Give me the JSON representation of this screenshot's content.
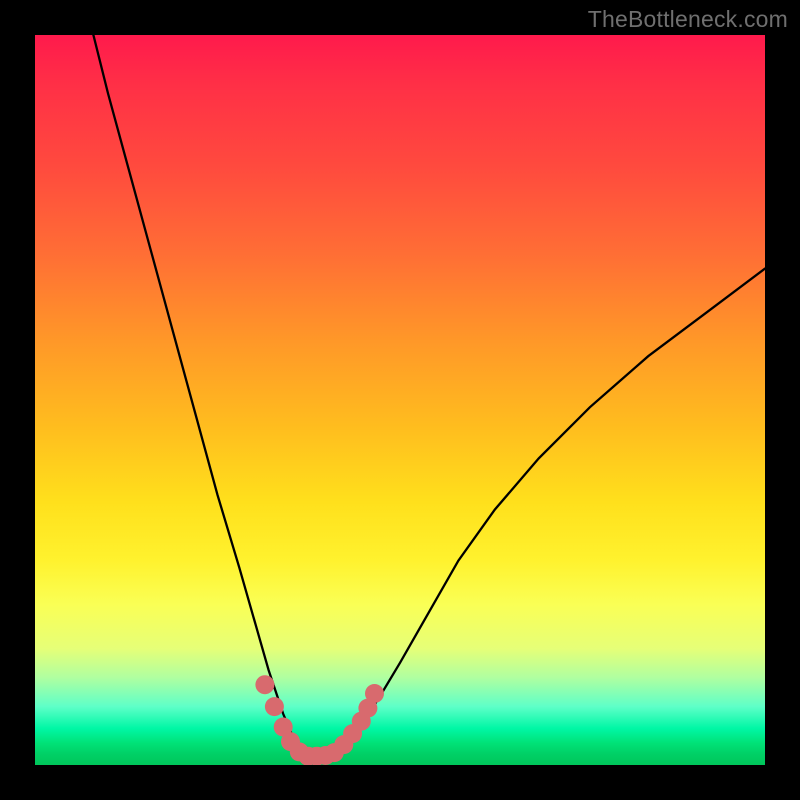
{
  "watermark": "TheBottleneck.com",
  "chart_data": {
    "type": "line",
    "title": "",
    "xlabel": "",
    "ylabel": "",
    "xlim": [
      0,
      100
    ],
    "ylim": [
      0,
      100
    ],
    "series": [
      {
        "name": "bottleneck-curve",
        "x": [
          8,
          10,
          13,
          16,
          19,
          22,
          25,
          28,
          30,
          32,
          34,
          35.5,
          37,
          38.5,
          40,
          42,
          44,
          47,
          50,
          54,
          58,
          63,
          69,
          76,
          84,
          92,
          100
        ],
        "y": [
          100,
          92,
          81,
          70,
          59,
          48,
          37,
          27,
          20,
          13,
          7,
          3.5,
          1.8,
          1.2,
          1.3,
          2.0,
          4.5,
          9,
          14,
          21,
          28,
          35,
          42,
          49,
          56,
          62,
          68
        ]
      }
    ],
    "highlight": {
      "name": "bottom-dots",
      "color": "#d86a6e",
      "points": [
        {
          "x": 31.5,
          "y": 11.0
        },
        {
          "x": 32.8,
          "y": 8.0
        },
        {
          "x": 34.0,
          "y": 5.2
        },
        {
          "x": 35.0,
          "y": 3.2
        },
        {
          "x": 36.2,
          "y": 1.8
        },
        {
          "x": 37.4,
          "y": 1.2
        },
        {
          "x": 38.6,
          "y": 1.2
        },
        {
          "x": 39.8,
          "y": 1.3
        },
        {
          "x": 41.0,
          "y": 1.7
        },
        {
          "x": 42.3,
          "y": 2.8
        },
        {
          "x": 43.5,
          "y": 4.3
        },
        {
          "x": 44.7,
          "y": 6.0
        },
        {
          "x": 45.6,
          "y": 7.8
        },
        {
          "x": 46.5,
          "y": 9.8
        }
      ]
    },
    "gradient_stops": [
      {
        "pos": 0,
        "color": "#ff1a4c"
      },
      {
        "pos": 50,
        "color": "#ffbe1e"
      },
      {
        "pos": 78,
        "color": "#faff55"
      },
      {
        "pos": 100,
        "color": "#00c65b"
      }
    ]
  }
}
